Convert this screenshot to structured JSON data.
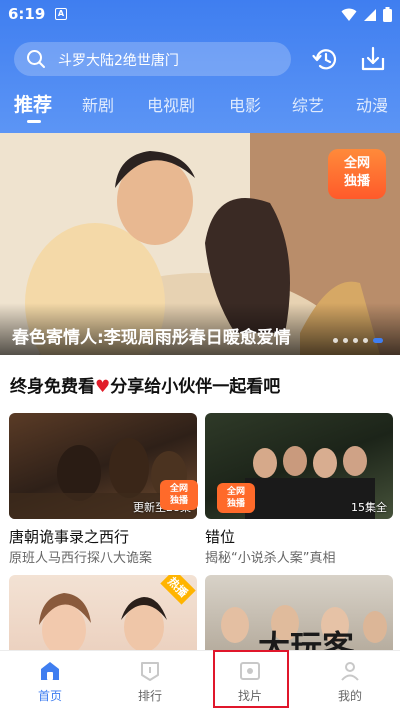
{
  "status_bar": {
    "time": "6:19",
    "notification": "A"
  },
  "search": {
    "query": "斗罗大陆2绝世唐门"
  },
  "tabs": [
    "推荐",
    "新剧",
    "电视剧",
    "电影",
    "综艺",
    "动漫"
  ],
  "banner": {
    "badge_line1": "全网",
    "badge_line2": "独播",
    "caption": "春色寄情人:李现周雨彤春日暖愈爱情"
  },
  "section": {
    "title_prefix": "终身免费看",
    "title_suffix": "分享给小伙伴一起看吧"
  },
  "cards": [
    {
      "title": "唐朝诡事录之西行",
      "subtitle": "原班人马西行探八大诡案",
      "tag": "更新至28集",
      "badge_line1": "全网",
      "badge_line2": "独播"
    },
    {
      "title": "错位",
      "subtitle": "揭秘“小说杀人案”真相",
      "tag": "15集全",
      "badge_line1": "全网",
      "badge_line2": "独播"
    },
    {
      "title": "",
      "subtitle": "",
      "tag": "",
      "corner": "热播"
    },
    {
      "title": "",
      "subtitle": "",
      "tag": ""
    }
  ],
  "bottom_nav": [
    {
      "label": "首页",
      "icon": "home-icon",
      "active": true
    },
    {
      "label": "排行",
      "icon": "ranking-icon",
      "active": false
    },
    {
      "label": "找片",
      "icon": "find-icon",
      "active": false
    },
    {
      "label": "我的",
      "icon": "profile-icon",
      "active": false
    }
  ],
  "watermark": "大玩客",
  "colors": {
    "primary": "#3f7ef0",
    "highlight_box": "#e0162b",
    "badge": "#ff5a2a",
    "heart": "#e11d2a"
  }
}
